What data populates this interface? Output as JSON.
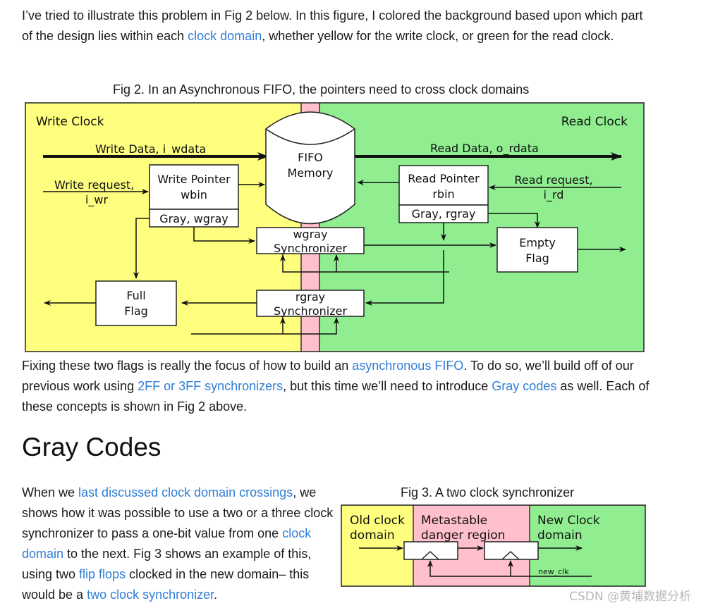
{
  "intro_paragraph": {
    "part1": "I’ve tried to illustrate this problem in Fig 2 below. In this figure, I colored the background based upon which part of the design lies within each ",
    "link1": "clock domain",
    "part2": ", whether yellow for the write clock, or green for the read clock."
  },
  "fig2": {
    "caption": "Fig 2. In an Asynchronous FIFO, the pointers need to cross clock domains",
    "colors": {
      "write_domain": "#ffff7f",
      "crossing": "#ffbfcc",
      "read_domain": "#90ee90"
    },
    "write_clock_label": "Write Clock",
    "read_clock_label": "Read Clock",
    "write_data_label": "Write Data, i_wdata",
    "read_data_label": "Read Data, o_rdata",
    "fifo_line1": "FIFO",
    "fifo_line2": "Memory",
    "write_request_line1": "Write request,",
    "write_request_line2": "i_wr",
    "read_request_line1": "Read request,",
    "read_request_line2": "i_rd",
    "write_pointer_line1": "Write Pointer",
    "write_pointer_line2": "wbin",
    "write_gray": "Gray, wgray",
    "read_pointer_line1": "Read Pointer",
    "read_pointer_line2": "rbin",
    "read_gray": "Gray, rgray",
    "wgray_sync_line1": "wgray",
    "wgray_sync_line2": "Synchronizer",
    "rgray_sync_line1": "rgray",
    "rgray_sync_line2": "Synchronizer",
    "full_flag_line1": "Full",
    "full_flag_line2": "Flag",
    "empty_flag_line1": "Empty",
    "empty_flag_line2": "Flag"
  },
  "fixing_paragraph": {
    "part1": "Fixing these two flags is really the focus of how to build an ",
    "link1": "asynchronous FIFO",
    "part2": ". To do so, we’ll build off of our previous work using ",
    "link2": "2FF or 3FF synchronizers",
    "part3": ", but this time we’ll need to introduce ",
    "link3": "Gray codes",
    "part4": " as well. Each of these concepts is shown in Fig 2 above."
  },
  "section_heading": "Gray Codes",
  "gray_paragraph": {
    "part1": "When we ",
    "link1": "last discussed clock domain crossings",
    "part2": ", we shows how it was possible to use a two or a three clock synchronizer to pass a one-bit value from one ",
    "link2": "clock domain",
    "part3": " to the next. Fig 3 shows an example of this, using two ",
    "link3": "flip flops",
    "part4": " clocked in the new domain– this would be a ",
    "link4": "two clock synchronizer",
    "part5": "."
  },
  "fig3": {
    "caption": "Fig 3. A two clock synchronizer",
    "old_domain_line1": "Old clock",
    "old_domain_line2": "domain",
    "metastable_line1": "Metastable",
    "metastable_line2": "danger region",
    "new_domain_line1": "New Clock",
    "new_domain_line2": "domain",
    "clock_signal": "new_clk"
  },
  "watermark": "CSDN @黄埔数据分析"
}
